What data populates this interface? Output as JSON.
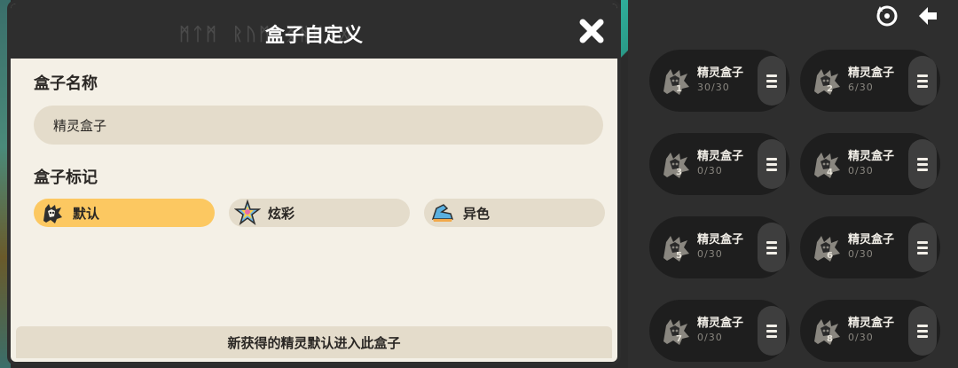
{
  "dialog": {
    "title": "盒子自定义",
    "header_watermark": "ᛗᛏᛗ ᚱᚢᛗ ᛝᚻᛗᚹᛞ"
  },
  "name_section": {
    "label": "盒子名称",
    "value": "精灵盒子"
  },
  "mark_section": {
    "label": "盒子标记",
    "options": [
      {
        "label": "默认",
        "icon": "default-spirit-icon",
        "selected": true
      },
      {
        "label": "炫彩",
        "icon": "rainbow-star-icon",
        "selected": false
      },
      {
        "label": "异色",
        "icon": "shiny-shoe-icon",
        "selected": false
      }
    ]
  },
  "footer": {
    "text": "新获得的精灵默认进入此盒子"
  },
  "right_panel": {
    "icons": [
      "refresh-icon",
      "back-arrow-icon"
    ],
    "boxes": [
      {
        "number": "1",
        "name": "精灵盒子",
        "count": "30/30"
      },
      {
        "number": "2",
        "name": "精灵盒子",
        "count": "6/30"
      },
      {
        "number": "3",
        "name": "精灵盒子",
        "count": "0/30"
      },
      {
        "number": "4",
        "name": "精灵盒子",
        "count": "0/30"
      },
      {
        "number": "5",
        "name": "精灵盒子",
        "count": "0/30"
      },
      {
        "number": "6",
        "name": "精灵盒子",
        "count": "0/30"
      },
      {
        "number": "7",
        "name": "精灵盒子",
        "count": "0/30"
      },
      {
        "number": "8",
        "name": "精灵盒子",
        "count": "0/30"
      }
    ]
  },
  "colors": {
    "dialog_bg": "#f4f0e6",
    "header_bg": "#2e2e2e",
    "field_bg": "#e4dccb",
    "selected_accent": "#fcc861",
    "panel_bg": "#2e2e2e",
    "card_bg": "#1e1e1e"
  }
}
